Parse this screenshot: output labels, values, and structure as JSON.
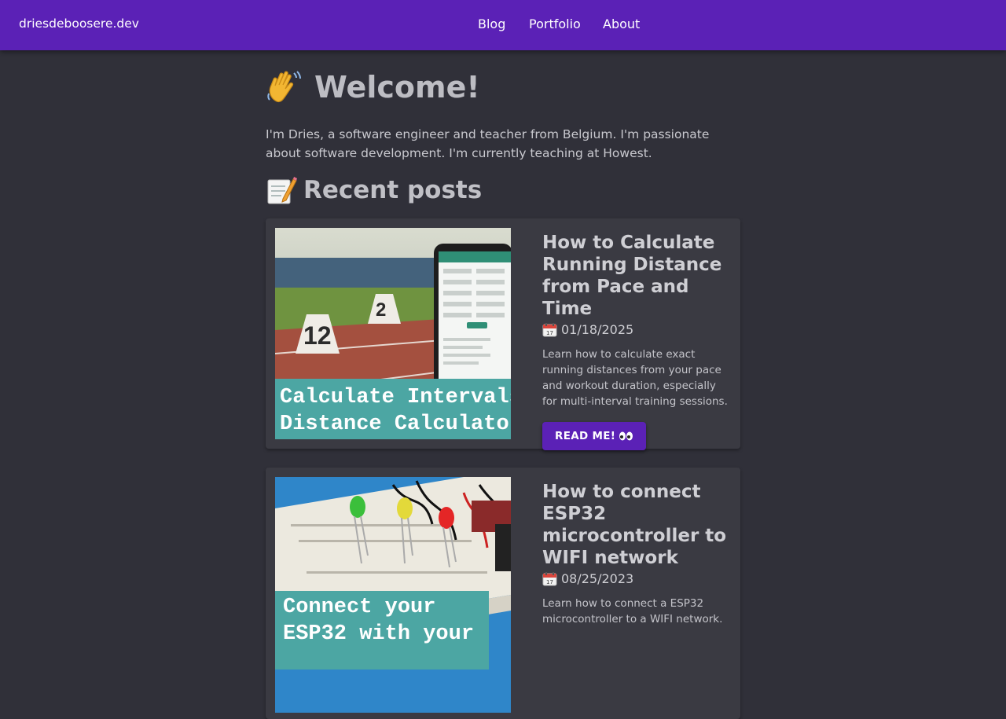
{
  "header": {
    "brand": "driesdeboosere.dev",
    "nav": [
      {
        "label": "Blog"
      },
      {
        "label": "Portfolio"
      },
      {
        "label": "About"
      }
    ]
  },
  "hero": {
    "emoji_icon": "waving-hand-icon",
    "title": "Welcome!",
    "intro": "I'm Dries, a software engineer and teacher from Belgium. I'm passionate about software development. I'm currently teaching at Howest."
  },
  "recent": {
    "emoji_icon": "memo-icon",
    "heading": "Recent posts"
  },
  "posts": [
    {
      "title": "How to Calculate Running Distance from Pace and Time",
      "date_icon": "calendar-icon",
      "date": "01/18/2025",
      "description": "Learn how to calculate exact running distances from your pace and workout duration, especially for multi-interval training sessions.",
      "button": "READ ME!",
      "button_icon": "eyes-icon",
      "image_caption_lines": [
        "Calculate Intervals",
        "Distance Calculator"
      ]
    },
    {
      "title": "How to connect ESP32 microcontroller to WIFI network",
      "date_icon": "calendar-icon",
      "date": "08/25/2023",
      "description": "Learn how to connect a ESP32 microcontroller to a WIFI network.",
      "image_caption_lines": [
        "Connect your",
        "ESP32 with your"
      ]
    }
  ],
  "colors": {
    "header_bg": "#5b21b6",
    "page_bg": "#303039",
    "card_bg": "#3a3a42",
    "button_bg": "#5b21b6"
  }
}
